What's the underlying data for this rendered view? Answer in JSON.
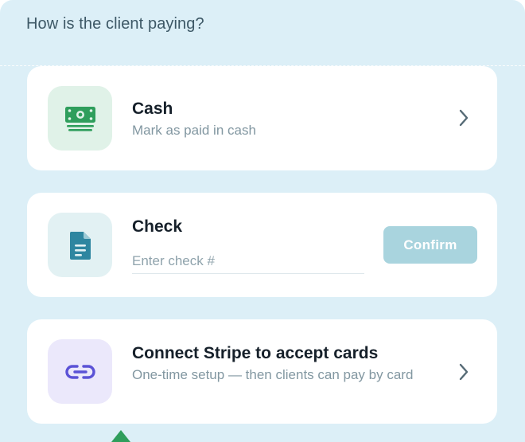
{
  "prompt": "How is the client paying?",
  "options": [
    {
      "id": "cash",
      "icon": "cash-icon",
      "title": "Cash",
      "subtitle": "Mark as paid in cash"
    },
    {
      "id": "check",
      "icon": "document-icon",
      "title": "Check",
      "input": {
        "placeholder": "Enter check #",
        "value": ""
      },
      "confirm_label": "Confirm"
    },
    {
      "id": "stripe",
      "icon": "link-icon",
      "title": "Connect Stripe to accept cards",
      "subtitle": "One-time setup — then clients can pay by card"
    }
  ],
  "colors": {
    "panel_bg": "#dceff7",
    "cash_accent": "#2f9e5c",
    "check_accent": "#2e86a0",
    "stripe_accent": "#5b52d6",
    "confirm_disabled": "#a9d4de"
  }
}
